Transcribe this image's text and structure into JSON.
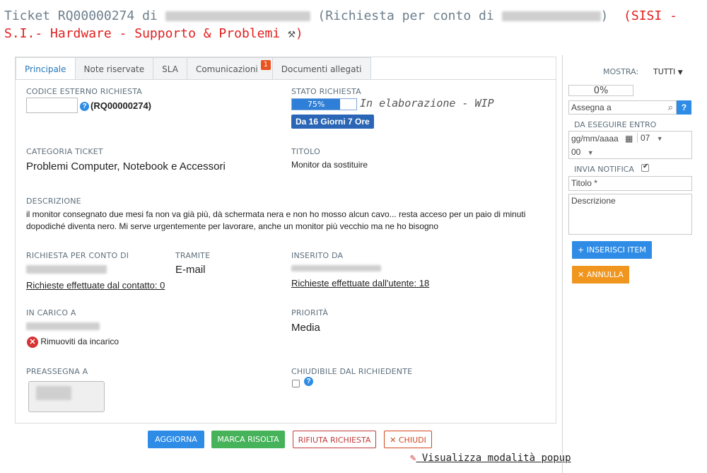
{
  "header": {
    "prefix": "Ticket RQ00000274 di ",
    "middle": "(Richiesta per conto di",
    "close_paren": ")",
    "red_text": "(SISI - S.I.- Hardware - Supporto & Problemi ",
    "red_close": ")"
  },
  "tabs": [
    {
      "label": "Principale"
    },
    {
      "label": "Note riservate"
    },
    {
      "label": "SLA"
    },
    {
      "label": "Comunicazioni",
      "badge": "1"
    },
    {
      "label": "Documenti allegati"
    }
  ],
  "fields": {
    "codice_label": "CODICE ESTERNO RICHIESTA",
    "codice_ref": "(RQ00000274)",
    "stato_label": "STATO RICHIESTA",
    "progress_pct": "75%",
    "progress_value": 0.75,
    "stato_text": "In elaborazione - WIP",
    "days_badge": "Da 16 Giorni 7 Ore",
    "categoria_label": "CATEGORIA TICKET",
    "categoria_value": "Problemi Computer, Notebook e Accessori",
    "titolo_label": "TITOLO",
    "titolo_value": "Monitor da sostituire",
    "descrizione_label": "DESCRIZIONE",
    "descrizione_value": "il monitor consegnato due mesi fa non va già più, dà schermata nera e non ho mosso alcun cavo... resta acceso per un paio di minuti dopodiché diventa nero. Mi serve urgentemente per lavorare, anche un monitor più vecchio ma ne ho bisogno",
    "richiesta_label": "RICHIESTA PER CONTO DI",
    "richiesta_link": "Richieste effettuate dal contatto: 0",
    "tramite_label": "TRAMITE",
    "tramite_value": "E-mail",
    "inserito_label": "INSERITO DA",
    "inserito_link": "Richieste effettuate dall'utente: 18",
    "incarico_label": "IN CARICO A",
    "rimuoviti": "Rimuoviti da incarico",
    "priorita_label": "PRIORITÀ",
    "priorita_value": "Media",
    "preassegna_label": "PREASSEGNA A",
    "chiudibile_label": "CHIUDIBILE DAL RICHIEDENTE"
  },
  "buttons": {
    "aggiorna": "AGGIORNA",
    "marca": "MARCA RISOLTA",
    "rifiuta": "RIFIUTA RICHIESTA",
    "chiudi": "CHIUDI"
  },
  "popup_link": "Visualizza modalità popup",
  "right_panel": {
    "mostra_label": "MOSTRA:",
    "mostra_value": "TUTTI",
    "pct": "0%",
    "assegna_placeholder": "Assegna a",
    "help": "?",
    "da_eseguire_label": "DA ESEGUIRE ENTRO",
    "date_placeholder": "gg/mm/aaaa",
    "hour": "07",
    "minute": "00",
    "invia_label": "INVIA NOTIFICA",
    "titolo_placeholder": "Titolo *",
    "descrizione_placeholder": "Descrizione",
    "inserisci": "INSERISCI ITEM",
    "annulla": "ANNULLA"
  },
  "colors": {
    "accent_blue": "#2e8ce6",
    "green": "#46b35a",
    "orange": "#f0961e",
    "red": "#e02020"
  }
}
